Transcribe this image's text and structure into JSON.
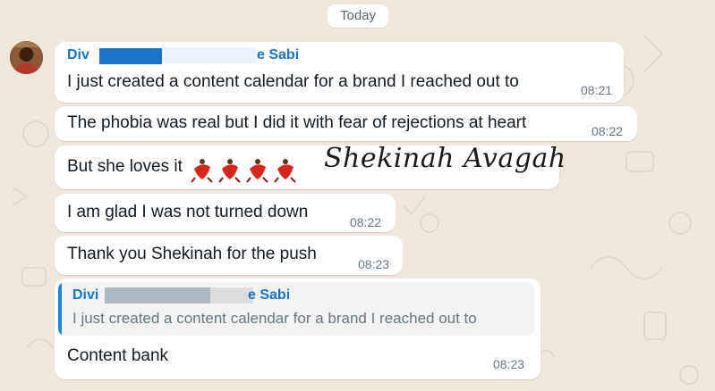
{
  "date_label": "Today",
  "sender": {
    "visible_start": "Div",
    "visible_end": "e Sabi"
  },
  "messages": [
    {
      "text": "I just created a content calendar for a brand I reached out to",
      "time": "08:21"
    },
    {
      "text": "The phobia was real but I did it with fear of rejections at heart",
      "time": "08:22"
    },
    {
      "text": "But she loves it"
    },
    {
      "text": "I am glad I was not turned down",
      "time": "08:22"
    },
    {
      "text": "Thank you Shekinah for the push",
      "time": "08:23"
    }
  ],
  "overlay_signature": "Shekinah Avagah",
  "reply": {
    "quoted_sender_start": "Divi",
    "quoted_sender_end": "e Sabi",
    "quoted_text": "I just created a content calendar for a brand I reached out to",
    "text": "Content bank",
    "time": "08:23"
  },
  "colors": {
    "background": "#efe7dc",
    "bubble": "#ffffff",
    "sender_name": "#1a73c8",
    "timestamp": "#667781",
    "quote_bar": "#1f84d6"
  },
  "icons": [
    "contact-avatar",
    "dancer-emoji"
  ]
}
